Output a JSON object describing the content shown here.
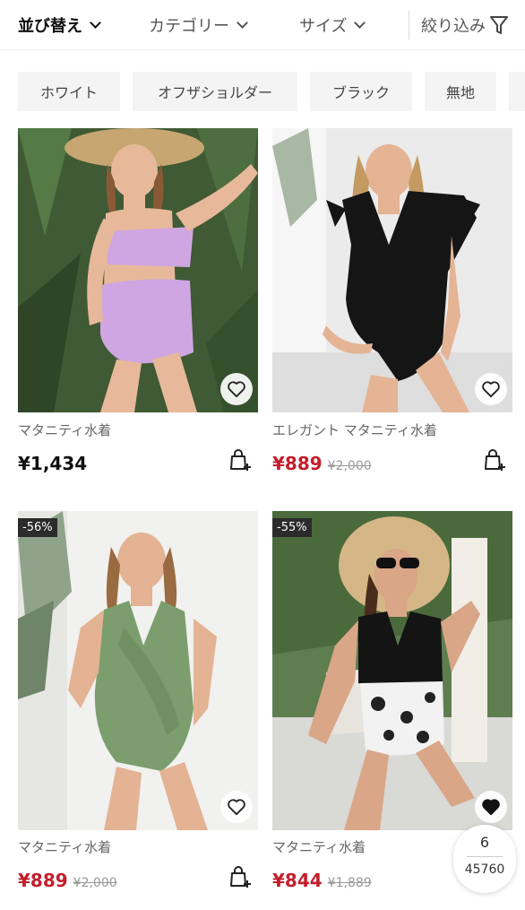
{
  "toolbar": {
    "sort_label": "並び替え",
    "category_label": "カテゴリー",
    "size_label": "サイズ",
    "filter_label": "絞り込み"
  },
  "chips": [
    "ホワイト",
    "オフザショルダー",
    "ブラック",
    "無地"
  ],
  "products": [
    {
      "name": "マタニティ水着",
      "price": "¥1,434",
      "original_price": "",
      "discount": "",
      "on_sale": false,
      "favorited": false
    },
    {
      "name": "エレガント マタニティ水着",
      "price": "¥889",
      "original_price": "¥2,000",
      "discount": "",
      "on_sale": true,
      "favorited": false
    },
    {
      "name": "マタニティ水着",
      "price": "¥889",
      "original_price": "¥2,000",
      "discount": "-56%",
      "on_sale": true,
      "favorited": false
    },
    {
      "name": "マタニティ水着",
      "price": "¥844",
      "original_price": "¥1,889",
      "discount": "-55%",
      "on_sale": true,
      "favorited": true
    }
  ],
  "pager": {
    "current": "6",
    "total": "45760"
  },
  "colors": {
    "sale_red": "#c41e2b",
    "chip_bg": "#f4f4f4",
    "badge_bg": "#2b2b2b"
  }
}
